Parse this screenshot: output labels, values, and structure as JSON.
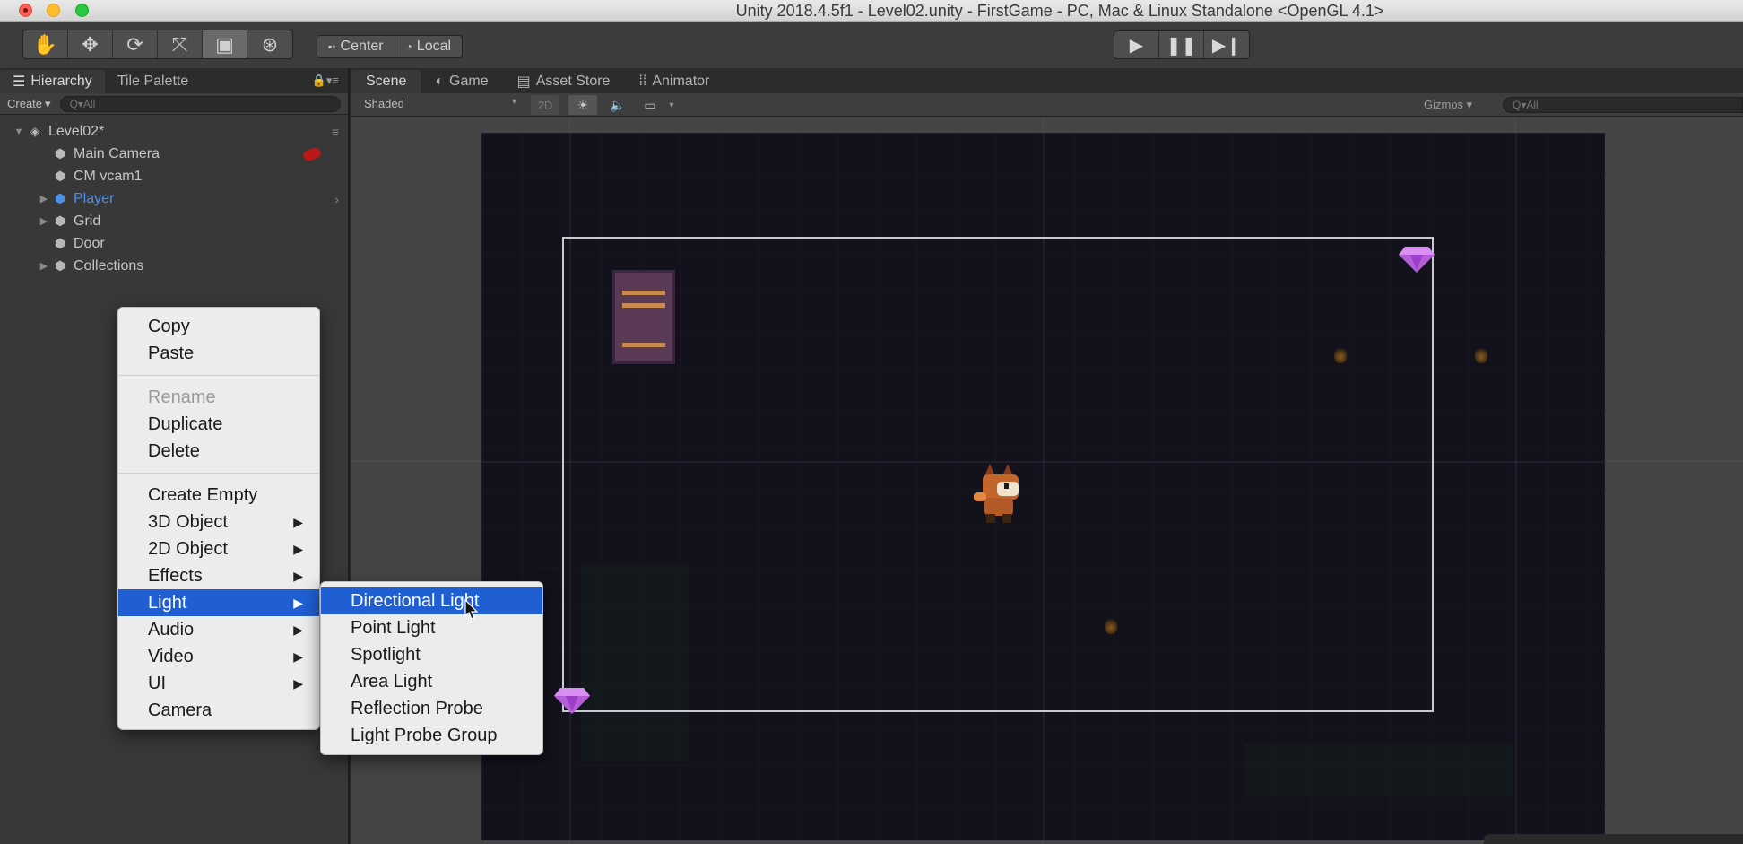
{
  "window": {
    "title": "Unity 2018.4.5f1 - Level02.unity - FirstGame - PC, Mac & Linux Standalone <OpenGL 4.1>"
  },
  "toolbar": {
    "tools": [
      "hand-icon",
      "move-icon",
      "rotate-icon",
      "scale-icon",
      "rect-icon",
      "transform-icon"
    ],
    "pivot_label": "Center",
    "space_label": "Local"
  },
  "hierarchy": {
    "tabs": [
      {
        "label": "Hierarchy"
      },
      {
        "label": "Tile Palette"
      }
    ],
    "create_label": "Create",
    "search_placeholder": "Q▾All",
    "scene_name": "Level02*",
    "items": [
      {
        "label": "Main Camera",
        "expandable": false
      },
      {
        "label": "CM vcam1",
        "expandable": false
      },
      {
        "label": "Player",
        "expandable": true,
        "selected_color": "#4f8fe6"
      },
      {
        "label": "Grid",
        "expandable": true
      },
      {
        "label": "Door",
        "expandable": false
      },
      {
        "label": "Collections",
        "expandable": true
      }
    ]
  },
  "scene": {
    "tabs": [
      {
        "label": "Scene"
      },
      {
        "label": "Game"
      },
      {
        "label": "Asset Store"
      },
      {
        "label": "Animator"
      }
    ],
    "shading_mode": "Shaded",
    "mode_2d": "2D",
    "gizmos_label": "Gizmos",
    "search_placeholder": "Q▾All"
  },
  "context_menu": {
    "items": [
      "Copy",
      "Paste",
      "Rename",
      "Duplicate",
      "Delete",
      "Create Empty",
      "3D Object",
      "2D Object",
      "Effects",
      "Light",
      "Audio",
      "Video",
      "UI",
      "Camera"
    ],
    "highlighted": "Light",
    "disabled": [
      "Rename"
    ]
  },
  "light_submenu": {
    "items": [
      "Directional Light",
      "Point Light",
      "Spotlight",
      "Area Light",
      "Reflection Probe",
      "Light Probe Group"
    ],
    "highlighted": "Directional Light"
  },
  "colors": {
    "accent": "#1f5fd1",
    "panel": "#383838",
    "scene_bg": "#13111c",
    "selection_blue": "#4f8fe6"
  }
}
